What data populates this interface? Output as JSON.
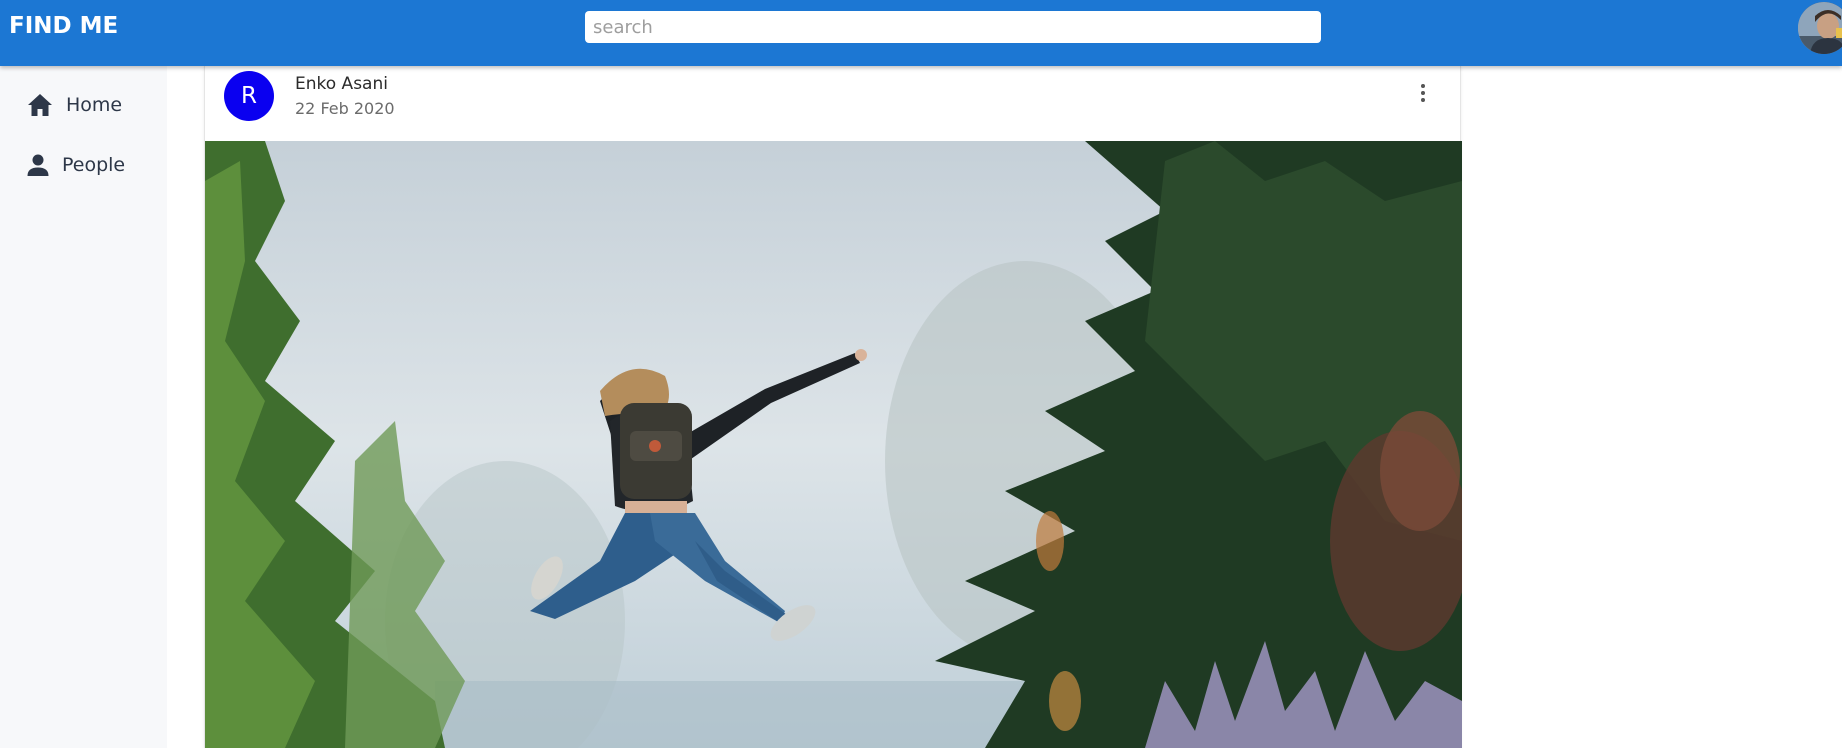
{
  "app": {
    "title": "FIND ME"
  },
  "search": {
    "placeholder": "search",
    "value": ""
  },
  "sidebar": {
    "items": [
      {
        "label": "Home",
        "icon": "home-icon"
      },
      {
        "label": "People",
        "icon": "person-icon"
      }
    ]
  },
  "post": {
    "avatar_letter": "R",
    "author": "Enko Asani",
    "date": "22 Feb 2020",
    "menu_icon": "more-vert-icon"
  },
  "colors": {
    "appbar": "#1c77d3",
    "avatar": "#0a00f0",
    "sidebar_bg": "#f7f8fa"
  }
}
